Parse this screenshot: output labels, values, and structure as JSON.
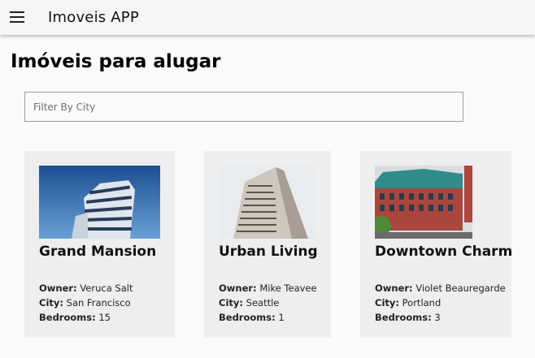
{
  "app": {
    "title": "Imoveis APP"
  },
  "page": {
    "title": "Imóveis para alugar"
  },
  "filter": {
    "placeholder": "Filter By City",
    "value": ""
  },
  "labels": {
    "owner": "Owner:",
    "city": "City:",
    "bedrooms": "Bedrooms:"
  },
  "listings": [
    {
      "name": "Grand Mansion",
      "owner": "Veruca Salt",
      "city": "San Francisco",
      "bedrooms": "15"
    },
    {
      "name": "Urban Living",
      "owner": "Mike Teavee",
      "city": "Seattle",
      "bedrooms": "1"
    },
    {
      "name": "Downtown Charm",
      "owner": "Violet Beauregarde",
      "city": "Portland",
      "bedrooms": "3"
    }
  ]
}
